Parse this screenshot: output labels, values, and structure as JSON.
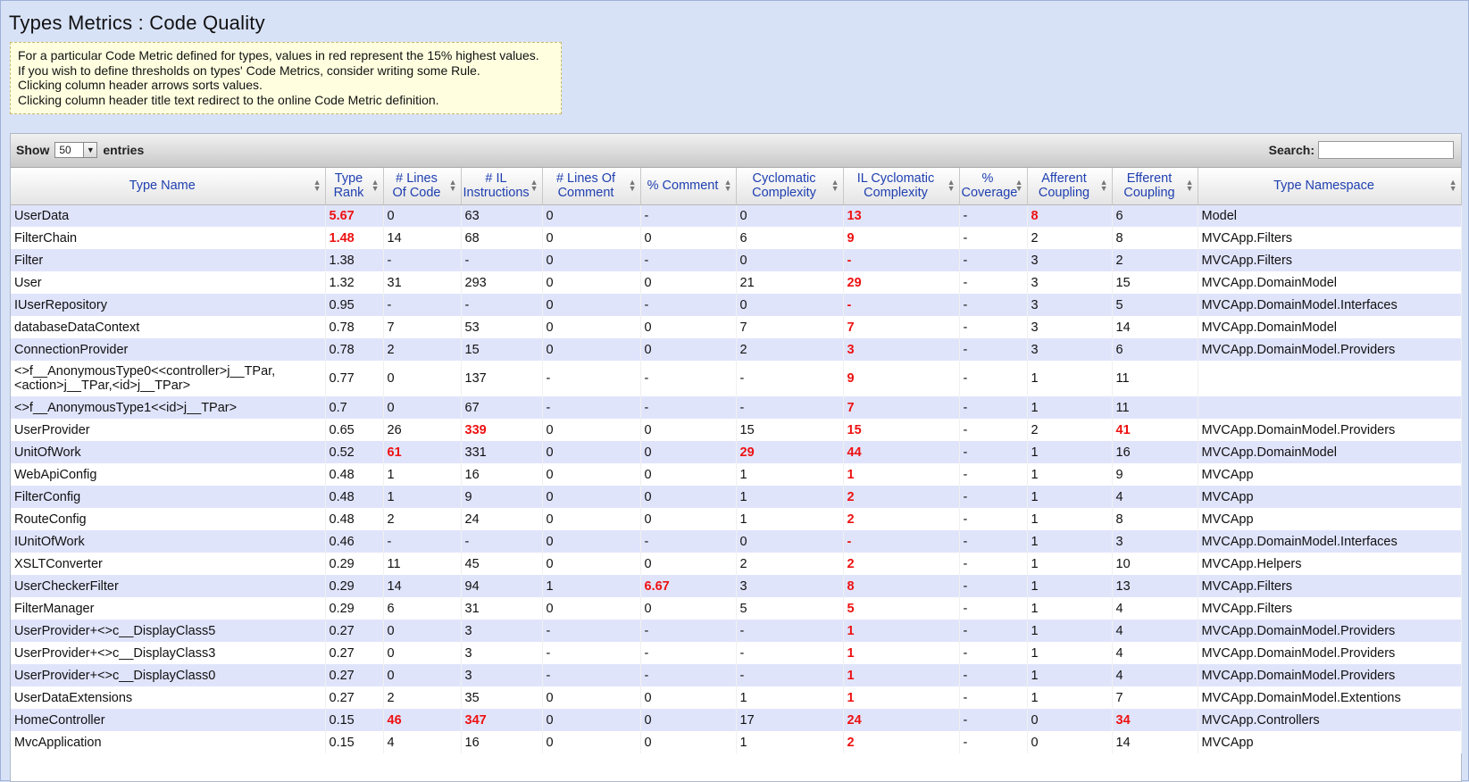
{
  "page": {
    "title": "Types Metrics : Code Quality",
    "notes": [
      "For a particular Code Metric defined for types, values in red represent the 15% highest values.",
      "If you wish to define thresholds on types' Code Metrics, consider writing some Rule.",
      "Clicking column header arrows sorts values.",
      "Clicking column header title text redirect to the online Code Metric definition."
    ]
  },
  "toolbar": {
    "show_label": "Show",
    "entries_value": "50",
    "entries_label": "entries",
    "search_label": "Search:",
    "search_value": ""
  },
  "colors": {
    "highlight": "#ee1111",
    "row_odd": "#e0e4fb",
    "header_text": "#2040b0"
  },
  "table": {
    "columns": [
      "Type Name",
      "Type\nRank",
      "# Lines\nOf Code",
      "# IL\nInstructions",
      "# Lines Of\nComment",
      "% Comment",
      "Cyclomatic\nComplexity",
      "IL Cyclomatic\nComplexity",
      "%\nCoverage",
      "Afferent\nCoupling",
      "Efferent\nCoupling",
      "Type Namespace"
    ],
    "rows": [
      {
        "cells": [
          "UserData",
          "5.67",
          "0",
          "63",
          "0",
          "-",
          "0",
          "13",
          "-",
          "8",
          "6",
          "Model"
        ],
        "hot": [
          1,
          7,
          9
        ]
      },
      {
        "cells": [
          "FilterChain",
          "1.48",
          "14",
          "68",
          "0",
          "0",
          "6",
          "9",
          "-",
          "2",
          "8",
          "MVCApp.Filters"
        ],
        "hot": [
          1,
          7
        ]
      },
      {
        "cells": [
          "Filter",
          "1.38",
          "-",
          "-",
          "0",
          "-",
          "0",
          "-",
          "-",
          "3",
          "2",
          "MVCApp.Filters"
        ],
        "hot": [
          7
        ]
      },
      {
        "cells": [
          "User",
          "1.32",
          "31",
          "293",
          "0",
          "0",
          "21",
          "29",
          "-",
          "3",
          "15",
          "MVCApp.DomainModel"
        ],
        "hot": [
          7
        ]
      },
      {
        "cells": [
          "IUserRepository",
          "0.95",
          "-",
          "-",
          "0",
          "-",
          "0",
          "-",
          "-",
          "3",
          "5",
          "MVCApp.DomainModel.Interfaces"
        ],
        "hot": [
          7
        ]
      },
      {
        "cells": [
          "databaseDataContext",
          "0.78",
          "7",
          "53",
          "0",
          "0",
          "7",
          "7",
          "-",
          "3",
          "14",
          "MVCApp.DomainModel"
        ],
        "hot": [
          7
        ]
      },
      {
        "cells": [
          "ConnectionProvider",
          "0.78",
          "2",
          "15",
          "0",
          "0",
          "2",
          "3",
          "-",
          "3",
          "6",
          "MVCApp.DomainModel.Providers"
        ],
        "hot": [
          7
        ]
      },
      {
        "cells": [
          "<>f__AnonymousType0<<controller>j__TPar, <action>j__TPar,<id>j__TPar>",
          "0.77",
          "0",
          "137",
          "-",
          "-",
          "-",
          "9",
          "-",
          "1",
          "11",
          ""
        ],
        "hot": [
          7
        ],
        "tall": true
      },
      {
        "cells": [
          "<>f__AnonymousType1<<id>j__TPar>",
          "0.7",
          "0",
          "67",
          "-",
          "-",
          "-",
          "7",
          "-",
          "1",
          "11",
          ""
        ],
        "hot": [
          7
        ]
      },
      {
        "cells": [
          "UserProvider",
          "0.65",
          "26",
          "339",
          "0",
          "0",
          "15",
          "15",
          "-",
          "2",
          "41",
          "MVCApp.DomainModel.Providers"
        ],
        "hot": [
          3,
          7,
          10
        ]
      },
      {
        "cells": [
          "UnitOfWork",
          "0.52",
          "61",
          "331",
          "0",
          "0",
          "29",
          "44",
          "-",
          "1",
          "16",
          "MVCApp.DomainModel"
        ],
        "hot": [
          2,
          6,
          7
        ]
      },
      {
        "cells": [
          "WebApiConfig",
          "0.48",
          "1",
          "16",
          "0",
          "0",
          "1",
          "1",
          "-",
          "1",
          "9",
          "MVCApp"
        ],
        "hot": [
          7
        ]
      },
      {
        "cells": [
          "FilterConfig",
          "0.48",
          "1",
          "9",
          "0",
          "0",
          "1",
          "2",
          "-",
          "1",
          "4",
          "MVCApp"
        ],
        "hot": [
          7
        ]
      },
      {
        "cells": [
          "RouteConfig",
          "0.48",
          "2",
          "24",
          "0",
          "0",
          "1",
          "2",
          "-",
          "1",
          "8",
          "MVCApp"
        ],
        "hot": [
          7
        ]
      },
      {
        "cells": [
          "IUnitOfWork",
          "0.46",
          "-",
          "-",
          "0",
          "-",
          "0",
          "-",
          "-",
          "1",
          "3",
          "MVCApp.DomainModel.Interfaces"
        ],
        "hot": [
          7
        ]
      },
      {
        "cells": [
          "XSLTConverter",
          "0.29",
          "11",
          "45",
          "0",
          "0",
          "2",
          "2",
          "-",
          "1",
          "10",
          "MVCApp.Helpers"
        ],
        "hot": [
          7
        ]
      },
      {
        "cells": [
          "UserCheckerFilter",
          "0.29",
          "14",
          "94",
          "1",
          "6.67",
          "3",
          "8",
          "-",
          "1",
          "13",
          "MVCApp.Filters"
        ],
        "hot": [
          5,
          7
        ]
      },
      {
        "cells": [
          "FilterManager",
          "0.29",
          "6",
          "31",
          "0",
          "0",
          "5",
          "5",
          "-",
          "1",
          "4",
          "MVCApp.Filters"
        ],
        "hot": [
          7
        ]
      },
      {
        "cells": [
          "UserProvider+<>c__DisplayClass5",
          "0.27",
          "0",
          "3",
          "-",
          "-",
          "-",
          "1",
          "-",
          "1",
          "4",
          "MVCApp.DomainModel.Providers"
        ],
        "hot": [
          7
        ]
      },
      {
        "cells": [
          "UserProvider+<>c__DisplayClass3",
          "0.27",
          "0",
          "3",
          "-",
          "-",
          "-",
          "1",
          "-",
          "1",
          "4",
          "MVCApp.DomainModel.Providers"
        ],
        "hot": [
          7
        ]
      },
      {
        "cells": [
          "UserProvider+<>c__DisplayClass0",
          "0.27",
          "0",
          "3",
          "-",
          "-",
          "-",
          "1",
          "-",
          "1",
          "4",
          "MVCApp.DomainModel.Providers"
        ],
        "hot": [
          7
        ]
      },
      {
        "cells": [
          "UserDataExtensions",
          "0.27",
          "2",
          "35",
          "0",
          "0",
          "1",
          "1",
          "-",
          "1",
          "7",
          "MVCApp.DomainModel.Extentions"
        ],
        "hot": [
          7
        ]
      },
      {
        "cells": [
          "HomeController",
          "0.15",
          "46",
          "347",
          "0",
          "0",
          "17",
          "24",
          "-",
          "0",
          "34",
          "MVCApp.Controllers"
        ],
        "hot": [
          2,
          3,
          7,
          10
        ]
      },
      {
        "cells": [
          "MvcApplication",
          "0.15",
          "4",
          "16",
          "0",
          "0",
          "1",
          "2",
          "-",
          "0",
          "14",
          "MVCApp"
        ],
        "hot": [
          7
        ]
      }
    ]
  }
}
